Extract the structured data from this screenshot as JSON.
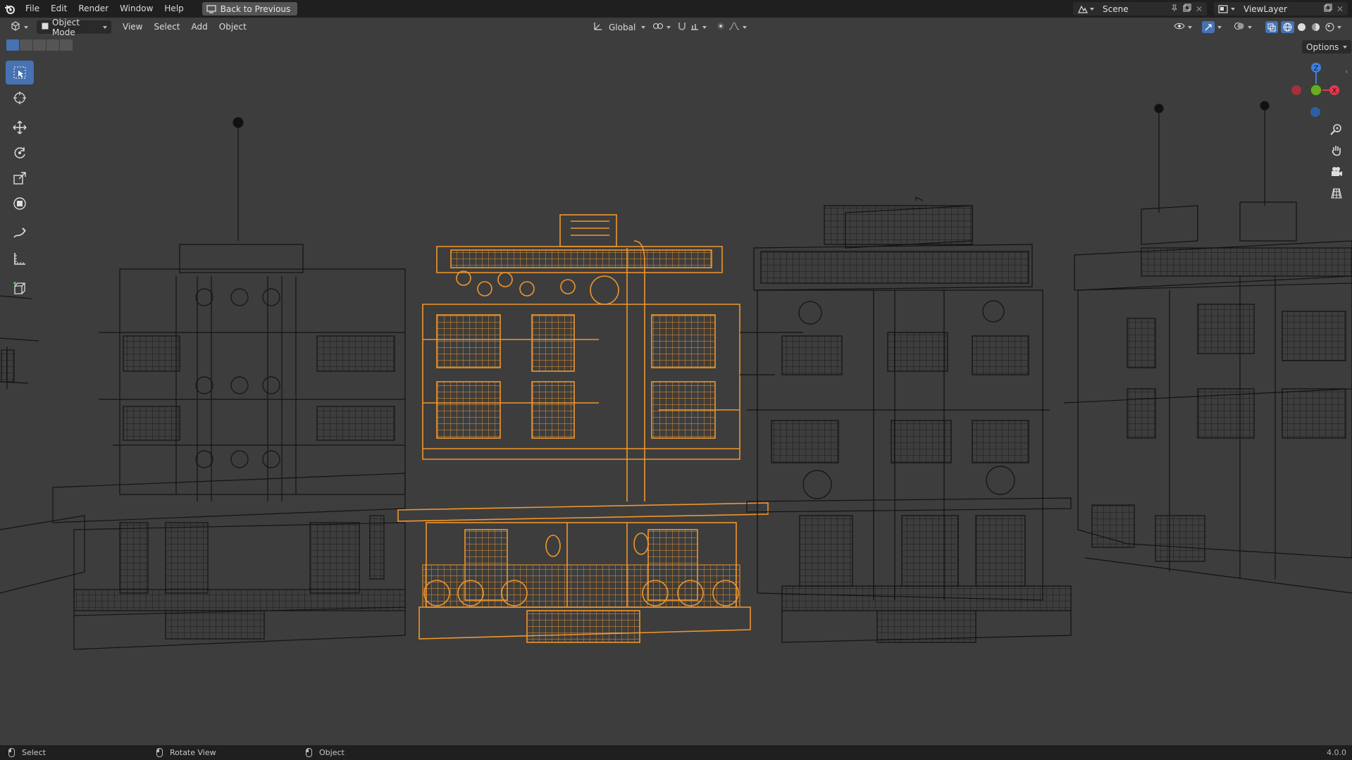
{
  "topbar": {
    "logo_icon": "blender-logo-icon",
    "menus": [
      "File",
      "Edit",
      "Render",
      "Window",
      "Help"
    ],
    "back_label": "Back to Previous",
    "scene_label": "Scene",
    "viewlayer_label": "ViewLayer"
  },
  "header": {
    "editor_icon": "3d-viewport-icon",
    "mode_label": "Object Mode",
    "menus": [
      "View",
      "Select",
      "Add",
      "Object"
    ],
    "orientation_label": "Global",
    "options_label": "Options"
  },
  "toolbar": {
    "tools": [
      "select-box",
      "cursor",
      "move",
      "rotate",
      "scale",
      "transform",
      "annotate",
      "measure",
      "add-cube"
    ],
    "active": "select-box"
  },
  "viewport": {
    "shading": "wireframe",
    "selected_color": "#f0962c",
    "wire_color": "#101010",
    "background": "#3d3d3d",
    "gizmo_axes": [
      "Z",
      "Y",
      "X"
    ]
  },
  "statusbar": {
    "left_label": "Select",
    "middle_label": "Rotate View",
    "right_label": "Object",
    "version": "4.0.0"
  },
  "colors": {
    "accent": "#4772b3",
    "axis_x": "#e2394d",
    "axis_y": "#6aa92b",
    "axis_z": "#3f7ed8"
  }
}
